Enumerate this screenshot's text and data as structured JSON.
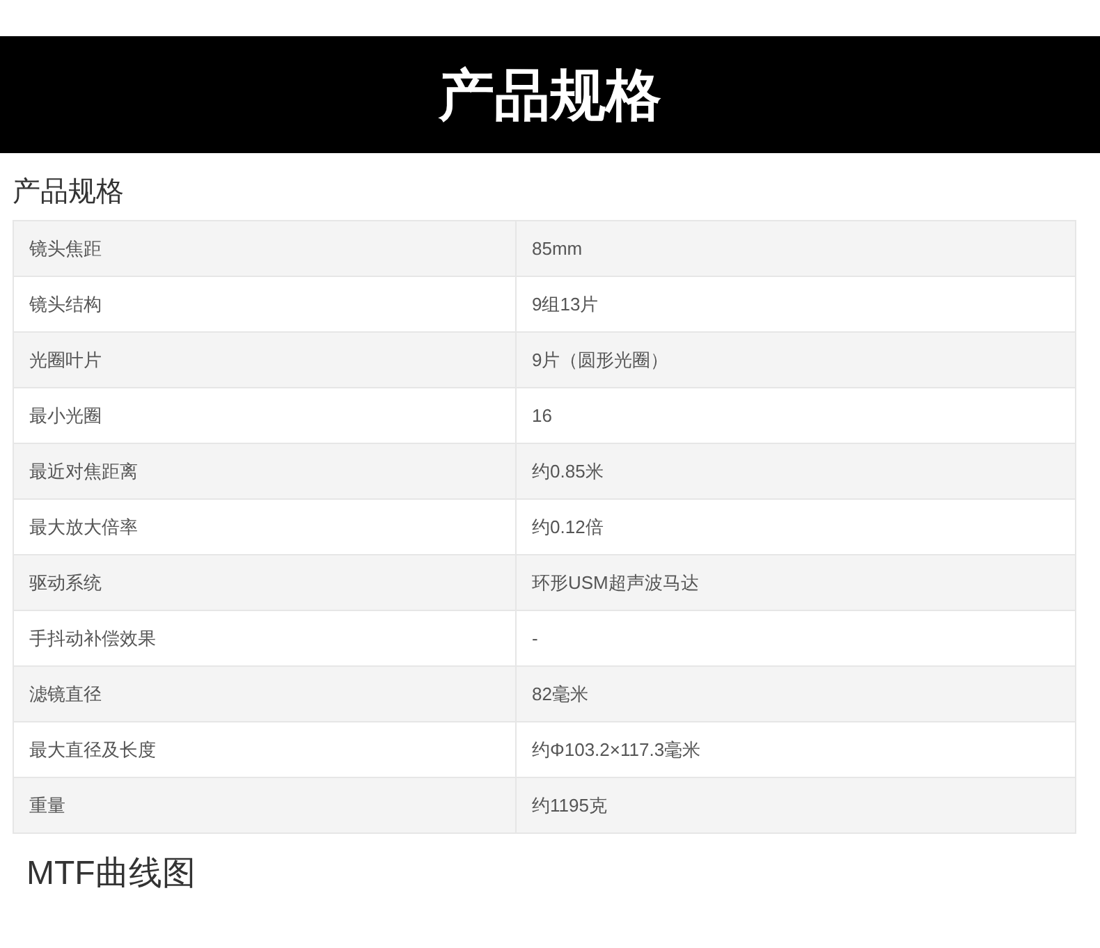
{
  "banner": {
    "title": "产品规格"
  },
  "specs": {
    "heading": "产品规格",
    "rows": [
      {
        "label": "镜头焦距",
        "value": "85mm"
      },
      {
        "label": "镜头结构",
        "value": "9组13片"
      },
      {
        "label": "光圈叶片",
        "value": "9片（圆形光圈）"
      },
      {
        "label": "最小光圈",
        "value": "16"
      },
      {
        "label": "最近对焦距离",
        "value": "约0.85米"
      },
      {
        "label": "最大放大倍率",
        "value": "约0.12倍"
      },
      {
        "label": "驱动系统",
        "value": "环形USM超声波马达"
      },
      {
        "label": "手抖动补偿效果",
        "value": "-"
      },
      {
        "label": "滤镜直径",
        "value": "82毫米"
      },
      {
        "label": "最大直径及长度",
        "value": "约Φ103.2×117.3毫米"
      },
      {
        "label": "重量",
        "value": "约1195克"
      }
    ]
  },
  "mtf": {
    "heading": "MTF曲线图"
  }
}
